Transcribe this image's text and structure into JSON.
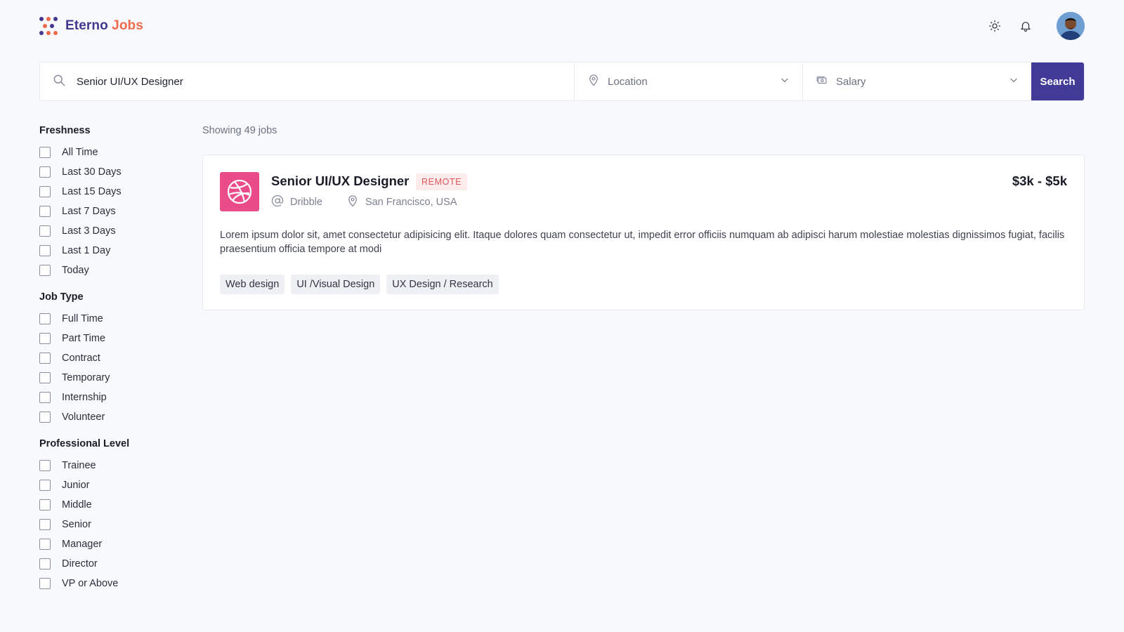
{
  "brand": {
    "part1": "Eterno",
    "part2": "Jobs",
    "color1": "#40398f",
    "color2": "#ef6a4b"
  },
  "header": {
    "icons": [
      "sun-icon",
      "bell-icon"
    ],
    "avatar": "user-avatar"
  },
  "search": {
    "query": "Senior UI/UX Designer",
    "location_label": "Location",
    "salary_label": "Salary",
    "button_label": "Search",
    "button_color": "#413a96"
  },
  "filters": {
    "freshness": {
      "title": "Freshness",
      "items": [
        "All Time",
        "Last 30 Days",
        "Last 15 Days",
        "Last 7 Days",
        "Last 3 Days",
        "Last 1 Day",
        "Today"
      ]
    },
    "job_type": {
      "title": "Job Type",
      "items": [
        "Full Time",
        "Part Time",
        "Contract",
        "Temporary",
        "Internship",
        "Volunteer"
      ]
    },
    "professional_level": {
      "title": "Professional Level",
      "items": [
        "Trainee",
        "Junior",
        "Middle",
        "Senior",
        "Manager",
        "Director",
        "VP or Above"
      ]
    }
  },
  "results": {
    "showing_text": "Showing 49 jobs",
    "jobs": [
      {
        "title": "Senior UI/UX Designer",
        "badge": "REMOTE",
        "company": "Dribble",
        "location": "San Francisco, USA",
        "salary": "$3k - $5k",
        "logo_color": "#ea4c89",
        "description": "Lorem ipsum dolor sit, amet consectetur adipisicing elit. Itaque dolores quam consectetur ut, impedit error officiis numquam ab adipisci harum molestiae molestias dignissimos fugiat, facilis praesentium officia tempore at modi",
        "tags": [
          "Web design",
          "UI /Visual Design",
          "UX Design / Research"
        ]
      }
    ]
  }
}
